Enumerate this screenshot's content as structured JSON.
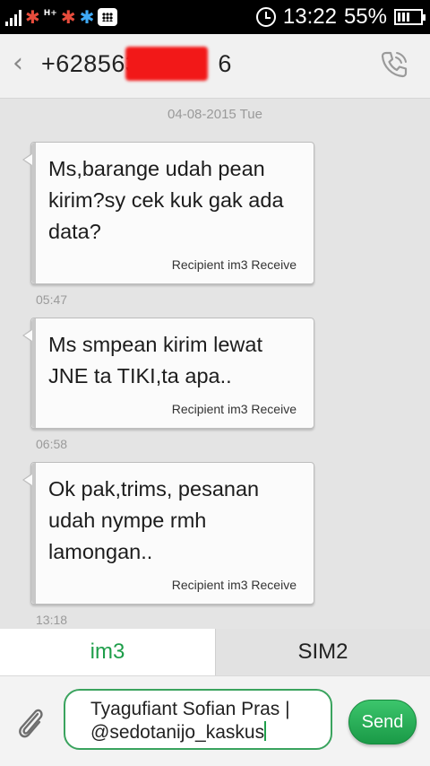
{
  "status_bar": {
    "network_badge": "H+",
    "time": "13:22",
    "battery": "55%",
    "icons": [
      "signal-icon",
      "pinwheel-icon",
      "bbm-icon",
      "alarm-icon",
      "battery-icon"
    ]
  },
  "header": {
    "contact_number": "+628563",
    "contact_number_tail": "6",
    "back_icon": "back-chevron-icon",
    "call_icon": "phone-icon"
  },
  "thread": {
    "date": "04-08-2015 Tue",
    "messages": [
      {
        "text": "Ms,barange udah pean kirim?sy cek kuk gak ada data?",
        "status": "Recipient im3 Receive",
        "time": "05:47"
      },
      {
        "text": "Ms smpean kirim lewat JNE ta TIKI,ta apa..",
        "status": "Recipient im3 Receive",
        "time": "06:58"
      },
      {
        "text": "Ok pak,trims, pesanan udah nympe rmh lamongan..",
        "status": "Recipient im3 Receive",
        "time": "13:18"
      }
    ]
  },
  "sim_bar": {
    "sim1": "im3",
    "sim2": "SIM2",
    "active_color": "#1e9e4a"
  },
  "composer": {
    "line1": "Tyagufiant Sofian Pras |",
    "line2": "@sedotanijo_kaskus",
    "send_label": "Send",
    "attach_icon": "paperclip-icon",
    "accent": "#3aa35e"
  }
}
